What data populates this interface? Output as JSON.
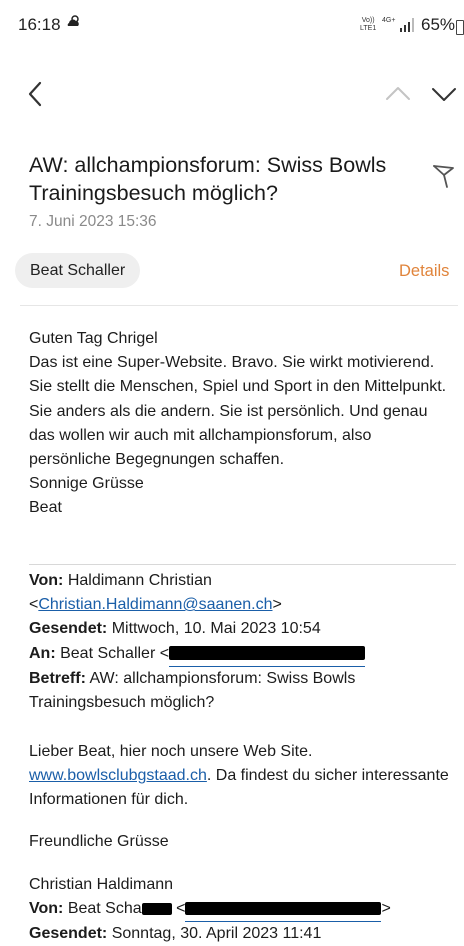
{
  "status": {
    "time": "16:18",
    "weather_icon": "cloud-sun-icon",
    "volte": "Vo))\nLTE1",
    "network": "4G+",
    "battery": "65%"
  },
  "nav": {
    "back_icon": "chevron-left-icon",
    "prev_icon": "chevron-up-icon",
    "next_icon": "chevron-down-icon"
  },
  "email": {
    "subject": "AW: allchampionsforum: Swiss Bowls Trainingsbesuch möglich?",
    "date": "7. Juni 2023  15:36",
    "sender": "Beat Schaller",
    "details_label": "Details",
    "accent_color": "#e0843b",
    "body_lines": [
      "Guten Tag Chrigel",
      "Das ist eine Super-Website. Bravo. Sie wirkt motivierend. Sie stellt die Menschen, Spiel und Sport in den Mittelpunkt. Sie anders als die andern. Sie ist persönlich. Und genau das wollen wir auch mit allchampionsforum, also persönliche Begegnungen schaffen.",
      "Sonnige Grüsse",
      "Beat"
    ],
    "quoted": {
      "from_label": "Von:",
      "from_name": "Haldimann Christian",
      "from_email": "Christian.Haldimann@saanen.ch",
      "sent_label": "Gesendet:",
      "sent_value": "Mittwoch, 10. Mai 2023 10:54",
      "to_label": "An:",
      "to_value": "Beat Schaller <",
      "subject_label": "Betreff:",
      "subject_value": "AW: allchampionsforum: Swiss Bowls Trainingsbesuch möglich?",
      "greeting": "Lieber Beat, hier noch unsere Web Site.",
      "website": "www.bowlsclubgstaad.ch",
      "website_suffix": ". Da findest du sicher interessante Informationen für dich.",
      "closing": "Freundliche Grüsse",
      "signature": "Christian Haldimann",
      "from2_label": "Von:",
      "from2_value": "Beat Scha",
      "from2_bracket": " <",
      "from2_close": ">",
      "sent2_label": "Gesendet:",
      "sent2_value": "Sonntag, 30. April 2023 11:41"
    }
  }
}
